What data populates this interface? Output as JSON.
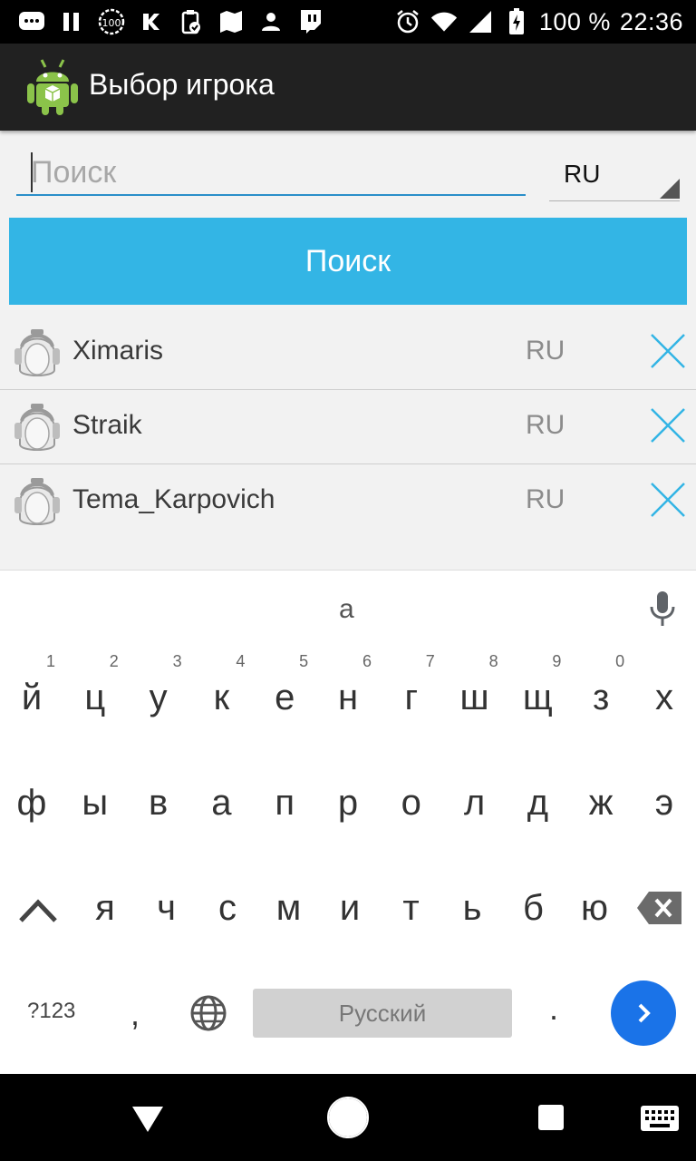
{
  "status_bar": {
    "battery": "100 %",
    "time": "22:36",
    "notification_icons": [
      "messages-icon",
      "pause-icon",
      "battery-100-icon",
      "vk-icon",
      "clipboard-icon",
      "map-icon",
      "person-icon",
      "twitch-icon"
    ],
    "system_icons": [
      "alarm-icon",
      "wifi-icon",
      "signal-icon",
      "battery-charging-icon"
    ]
  },
  "app_bar": {
    "title": "Выбор игрока"
  },
  "search": {
    "placeholder": "Поиск",
    "region_value": "RU",
    "button_label": "Поиск"
  },
  "players": [
    {
      "name": "Ximaris",
      "region": "RU"
    },
    {
      "name": "Straik",
      "region": "RU"
    },
    {
      "name": "Tema_Karpovich",
      "region": "RU"
    }
  ],
  "keyboard": {
    "suggestion": "а",
    "row1": [
      {
        "ch": "й",
        "hint": "1"
      },
      {
        "ch": "ц",
        "hint": "2"
      },
      {
        "ch": "у",
        "hint": "3"
      },
      {
        "ch": "к",
        "hint": "4"
      },
      {
        "ch": "е",
        "hint": "5"
      },
      {
        "ch": "н",
        "hint": "6"
      },
      {
        "ch": "г",
        "hint": "7"
      },
      {
        "ch": "ш",
        "hint": "8"
      },
      {
        "ch": "щ",
        "hint": "9"
      },
      {
        "ch": "з",
        "hint": "0"
      },
      {
        "ch": "х",
        "hint": ""
      }
    ],
    "row2": [
      "ф",
      "ы",
      "в",
      "а",
      "п",
      "р",
      "о",
      "л",
      "д",
      "ж",
      "э"
    ],
    "row3": [
      "я",
      "ч",
      "с",
      "м",
      "и",
      "т",
      "ь",
      "б",
      "ю"
    ],
    "symbols_label": "?123",
    "comma": ",",
    "space_label": "Русский",
    "period": "."
  },
  "colors": {
    "accent": "#33b5e5",
    "input_underline": "#2a8fc9",
    "enter_key": "#1a73e8",
    "app_bar": "#212121"
  }
}
